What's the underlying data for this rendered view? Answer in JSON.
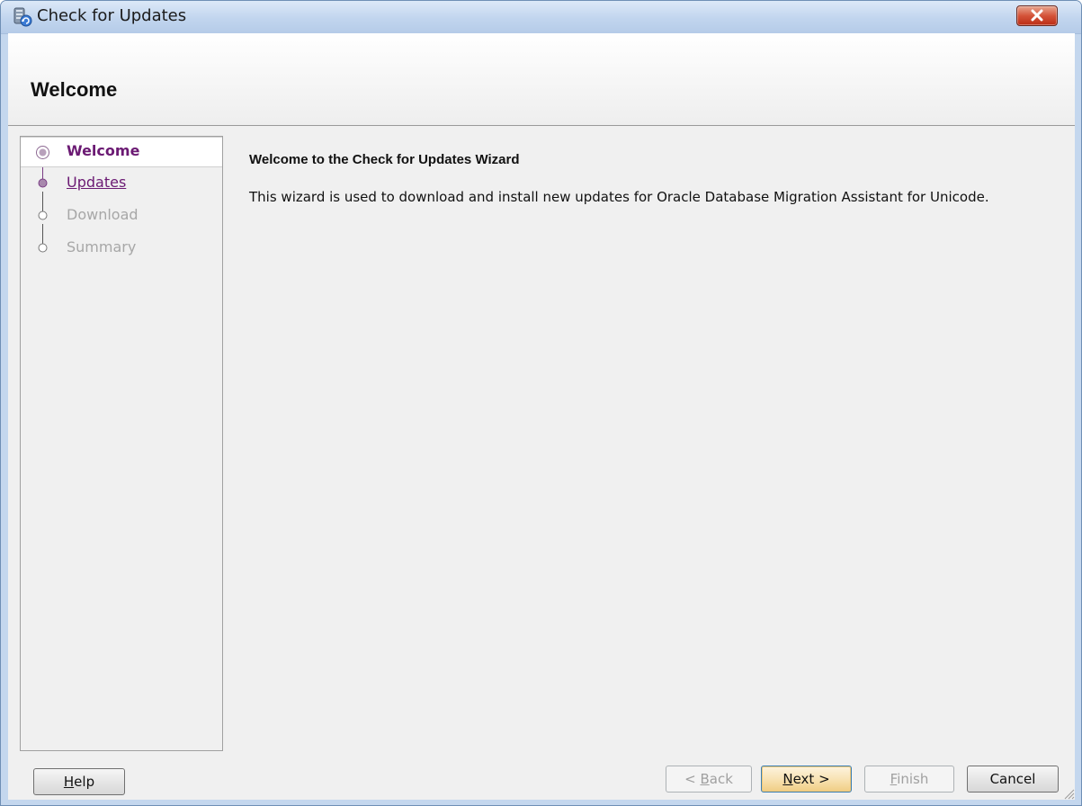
{
  "window": {
    "title": "Check for Updates",
    "app_icon": "database-update-icon",
    "close_icon": "close-icon"
  },
  "header": {
    "title": "Welcome"
  },
  "nav": {
    "steps": [
      {
        "label": "Welcome",
        "state": "current"
      },
      {
        "label": "Updates",
        "state": "link"
      },
      {
        "label": "Download",
        "state": "disabled"
      },
      {
        "label": "Summary",
        "state": "disabled"
      }
    ]
  },
  "content": {
    "heading": "Welcome to the Check for Updates Wizard",
    "description": "This wizard is used to download and install new updates for Oracle Database Migration Assistant for Unicode."
  },
  "buttons": {
    "help": {
      "label": "Help",
      "mnemonic": "H",
      "rest": "elp"
    },
    "back": {
      "label": "< Back",
      "pre": "< ",
      "mnemonic": "B",
      "rest": "ack"
    },
    "next": {
      "label": "Next >",
      "mnemonic": "N",
      "rest": "ext >"
    },
    "finish": {
      "label": "Finish",
      "mnemonic": "F",
      "rest": "inish"
    },
    "cancel": {
      "label": "Cancel"
    }
  },
  "colors": {
    "accent": "#6b1a73",
    "disabled_text": "#a7a7a7",
    "close_button": "#c9442a",
    "titlebar": "#c4d7ee"
  }
}
